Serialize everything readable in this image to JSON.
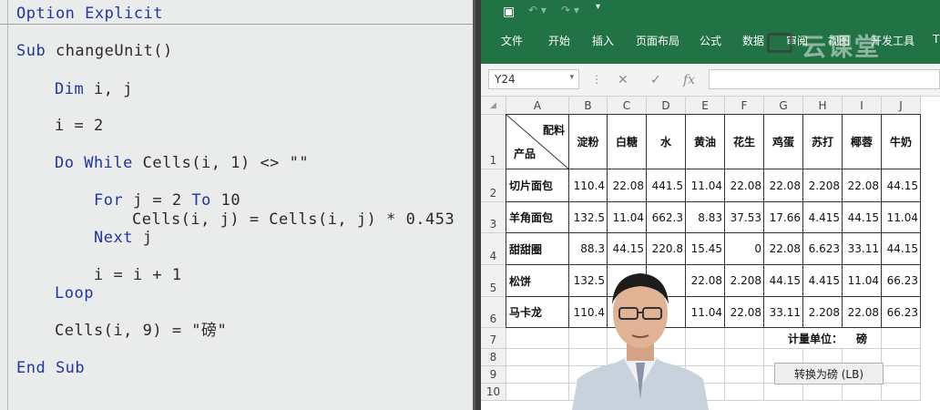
{
  "code": {
    "lines": [
      "Option Explicit",
      "Sub changeUnit()",
      "Dim i, j",
      "i = 2",
      "Do While Cells(i, 1) <> \"\"",
      "For j = 2 To 10",
      "Cells(i, j) = Cells(i, j) * 0.453",
      "Next j",
      "i = i + 1",
      "Loop",
      "Cells(i, 9) = \"磅\"",
      "End Sub"
    ]
  },
  "excel": {
    "ribbon_tabs": [
      "文件",
      "开始",
      "插入",
      "页面布局",
      "公式",
      "数据",
      "审阅",
      "视图",
      "开发工具",
      "T"
    ],
    "watermark": "云课堂",
    "name_box": "Y24",
    "column_headers": [
      "A",
      "B",
      "C",
      "D",
      "E",
      "F",
      "G",
      "H",
      "I",
      "J"
    ],
    "row_headers": [
      "1",
      "2",
      "3",
      "4",
      "5",
      "6",
      "7",
      "8",
      "9",
      "10"
    ],
    "header_corner": {
      "top": "配料",
      "bottom": "产品"
    },
    "ingredients": [
      "淀粉",
      "白糖",
      "水",
      "黄油",
      "花生",
      "鸡蛋",
      "苏打",
      "椰蓉",
      "牛奶"
    ],
    "rows": [
      {
        "product": "切片面包",
        "values": [
          "110.4",
          "22.08",
          "441.5",
          "11.04",
          "22.08",
          "22.08",
          "2.208",
          "22.08",
          "44.15"
        ]
      },
      {
        "product": "羊角面包",
        "values": [
          "132.5",
          "11.04",
          "662.3",
          "8.83",
          "37.53",
          "17.66",
          "4.415",
          "44.15",
          "11.04"
        ]
      },
      {
        "product": "甜甜圈",
        "values": [
          "88.3",
          "44.15",
          "220.8",
          "15.45",
          "0",
          "22.08",
          "6.623",
          "33.11",
          "44.15"
        ]
      },
      {
        "product": "松饼",
        "values": [
          "132.5",
          "4",
          "",
          "22.08",
          "2.208",
          "44.15",
          "4.415",
          "11.04",
          "66.23"
        ]
      },
      {
        "product": "马卡龙",
        "values": [
          "110.4",
          "",
          "",
          "11.04",
          "22.08",
          "33.11",
          "2.208",
          "22.08",
          "66.23"
        ]
      }
    ],
    "unit_label": "计量单位：",
    "unit_value": "磅",
    "convert_button": "转换为磅 (LB)"
  }
}
